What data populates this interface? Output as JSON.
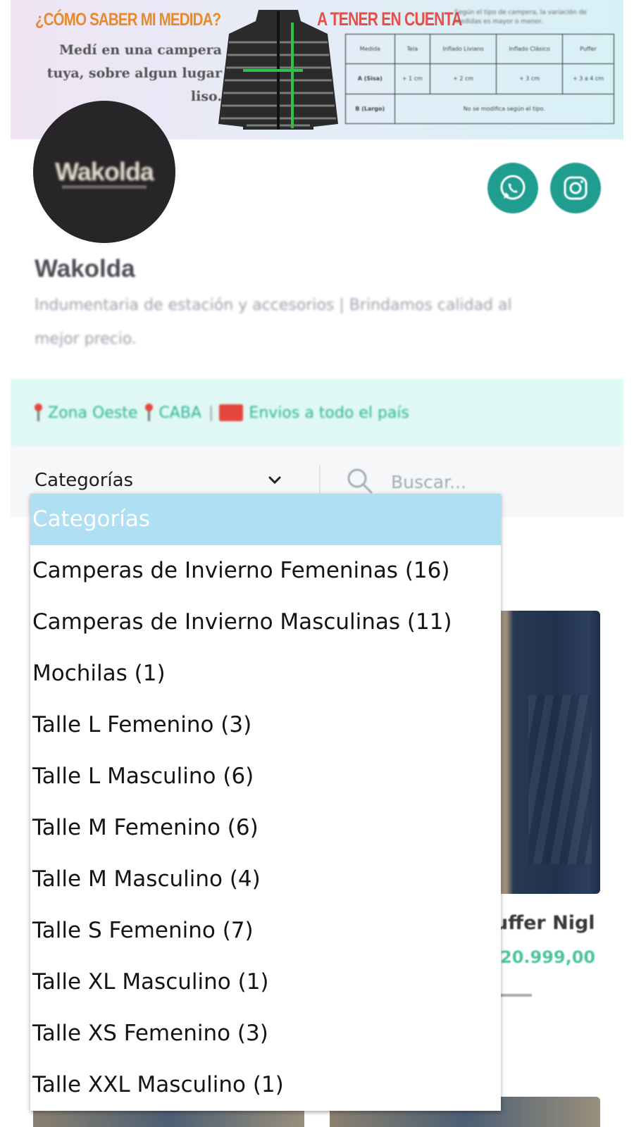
{
  "banner": {
    "title": "¿CÓMO SABER MI MEDIDA?",
    "instructions": "Medí en una campera tuya, sobre algun lugar liso.",
    "title2": "A TENER EN CUENTA",
    "note": "Según el tipo de campera, la variación de medidas es mayor o menor.",
    "table": {
      "headers": [
        "Medida",
        "Tela",
        "Inflado Liviano",
        "Inflado Clásico",
        "Puffer"
      ],
      "rows": [
        [
          "A (Sisa)",
          "+ 1 cm",
          "+ 2 cm",
          "+ 3 cm",
          "+ 3 a 4 cm"
        ],
        [
          "B (Largo)",
          "No se modifica según el tipo."
        ]
      ]
    }
  },
  "store": {
    "logo_text": "Wakolda",
    "name": "Wakolda",
    "description": "Indumentaria de estación y accesorios | Brindamos calidad al mejor precio."
  },
  "social": {
    "whatsapp_icon": "whatsapp-icon",
    "instagram_icon": "instagram-icon",
    "color": "#1f9e8f"
  },
  "info": {
    "zone1": "Zona Oeste",
    "zone2": "CABA",
    "separator": "|",
    "shipping": "Envios a todo el país"
  },
  "filter": {
    "category_label": "Categorías",
    "search_placeholder": "Buscar..."
  },
  "dropdown": {
    "options": [
      "Categorías",
      "Camperas de Invierno Femeninas (16)",
      "Camperas de Invierno Masculinas (11)",
      "Mochilas (1)",
      "Talle L Femenino (3)",
      "Talle L Masculino (6)",
      "Talle M Femenino (6)",
      "Talle M Masculino (4)",
      "Talle S Femenino (7)",
      "Talle XL Masculino (1)",
      "Talle XS Femenino (3)",
      "Talle XXL Masculino (1)"
    ],
    "selected_index": 0,
    "highlight_color": "#aedff2"
  },
  "product": {
    "name_visible": "uffer Nigl",
    "price_visible": "20.999,00"
  }
}
